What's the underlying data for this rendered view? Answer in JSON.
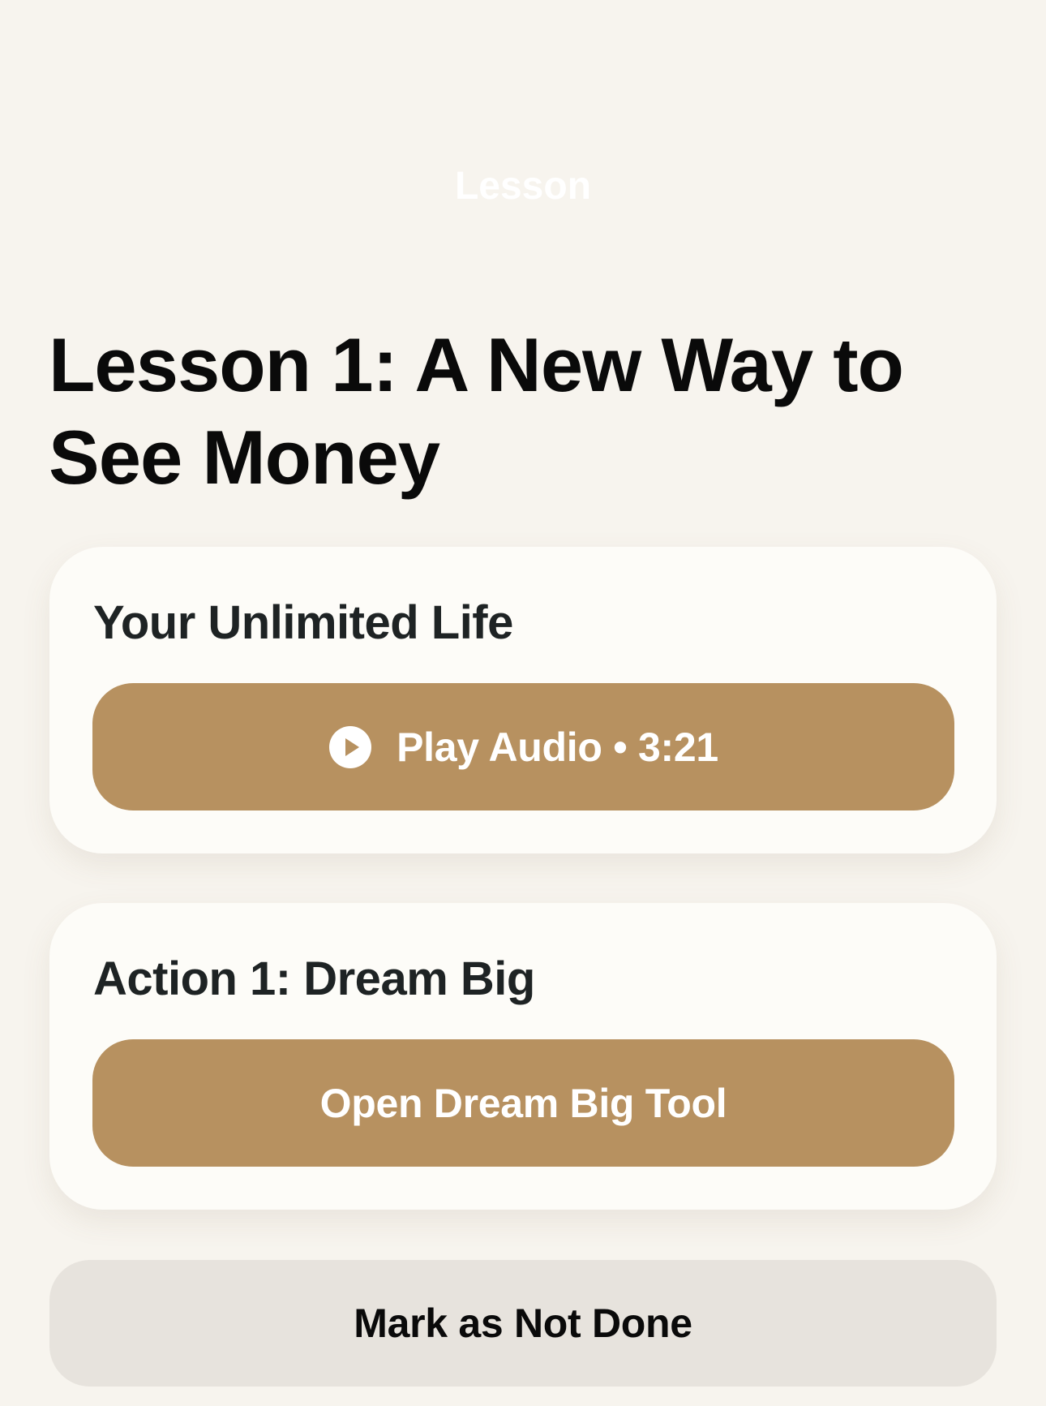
{
  "nav": {
    "title": "Lesson"
  },
  "lesson": {
    "title": "Lesson 1: A New Way to See Money"
  },
  "audio_card": {
    "title": "Your Unlimited Life",
    "play_icon": "play-circle-icon",
    "button_label": "Play Audio • 3:21"
  },
  "action_card": {
    "title": "Action 1: Dream Big",
    "button_label": "Open Dream Big Tool"
  },
  "footer": {
    "mark_label": "Mark as Not Done"
  },
  "colors": {
    "background": "#f7f4ee",
    "card": "#fdfcf8",
    "accent": "#b79160",
    "secondary_button": "#e7e3dd",
    "title_text": "#0a0a0a"
  }
}
